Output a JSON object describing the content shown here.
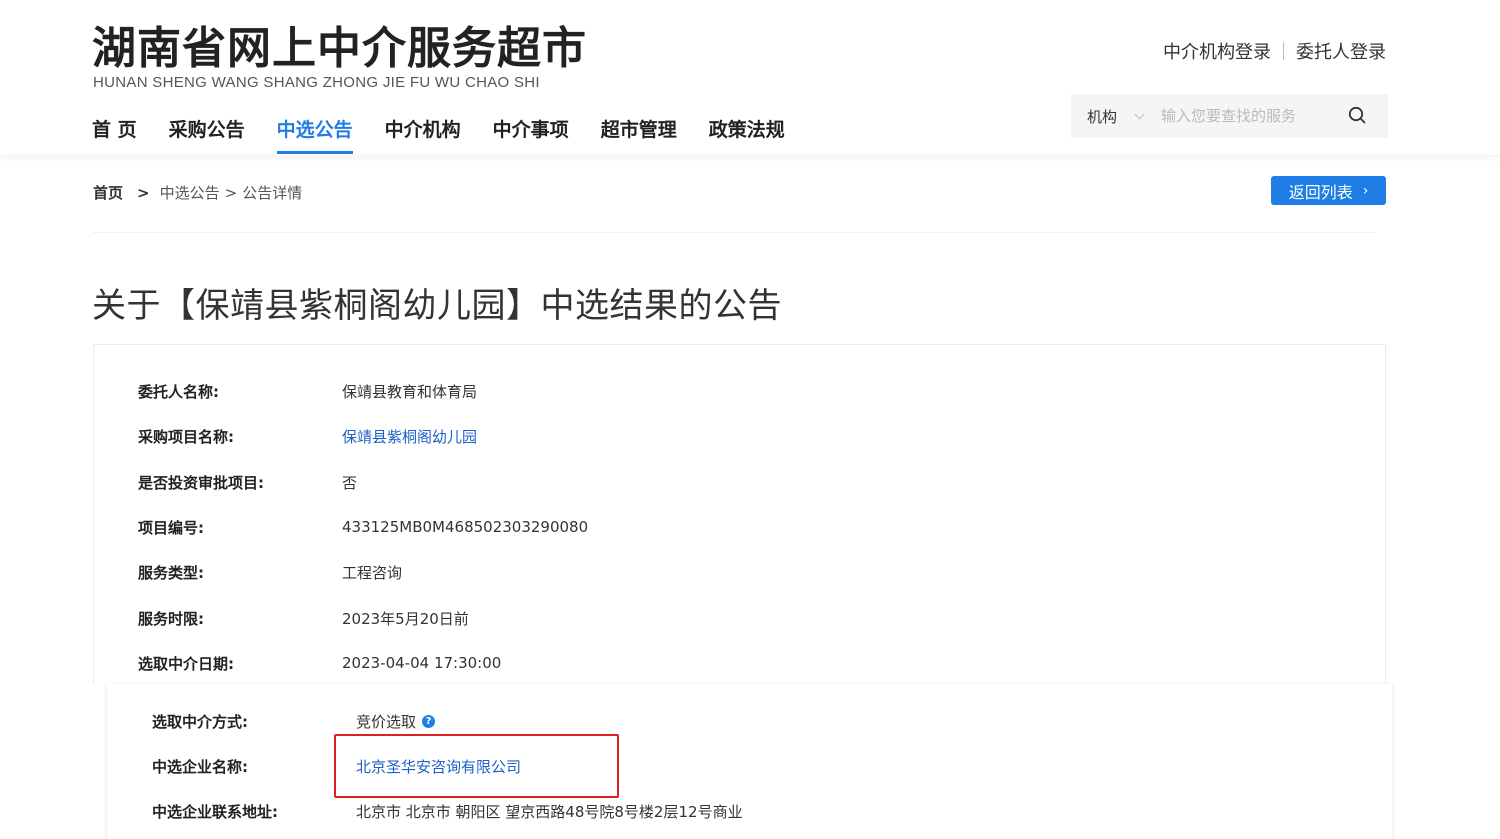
{
  "header": {
    "logo_cn": "湖南省网上中介服务超市",
    "logo_en": "HUNAN SHENG WANG SHANG ZHONG JIE FU WU CHAO SHI",
    "login_agency": "中介机构登录",
    "login_client": "委托人登录",
    "nav": [
      "首 页",
      "采购公告",
      "中选公告",
      "中介机构",
      "中介事项",
      "超市管理",
      "政策法规"
    ],
    "active_nav": "中选公告",
    "search": {
      "category": "机构",
      "placeholder": "输入您要查找的服务"
    }
  },
  "breadcrumb": {
    "home": "首页",
    "sep1": ">",
    "level1": "中选公告",
    "sep2": ">",
    "level2": "公告详情"
  },
  "back_button": {
    "label": "返回列表",
    "arrow": "›"
  },
  "title": "关于【保靖县紫桐阁幼儿园】中选结果的公告",
  "details": [
    {
      "label": "委托人名称:",
      "value": "保靖县教育和体育局"
    },
    {
      "label": "采购项目名称:",
      "value": "保靖县紫桐阁幼儿园"
    },
    {
      "label": "是否投资审批项目:",
      "value": "否"
    },
    {
      "label": "项目编号:",
      "value": "433125MB0M468502303290080"
    },
    {
      "label": "服务类型:",
      "value": "工程咨询"
    },
    {
      "label": "服务时限:",
      "value": "2023年5月20日前"
    },
    {
      "label": "选取中介日期:",
      "value": "2023-04-04 17:30:00"
    },
    {
      "label": "选取中介方式:",
      "value": "竞价选取",
      "help": "?"
    },
    {
      "label": "中选企业名称:",
      "value": "北京圣华安咨询有限公司"
    },
    {
      "label": "中选企业联系地址:",
      "value": "北京市 北京市 朝阳区 望京西路48号院8号楼2层12号商业"
    }
  ],
  "colors": {
    "accent": "#1f7de6",
    "link": "#1f5fc7",
    "highlight_box": "#e02020"
  }
}
